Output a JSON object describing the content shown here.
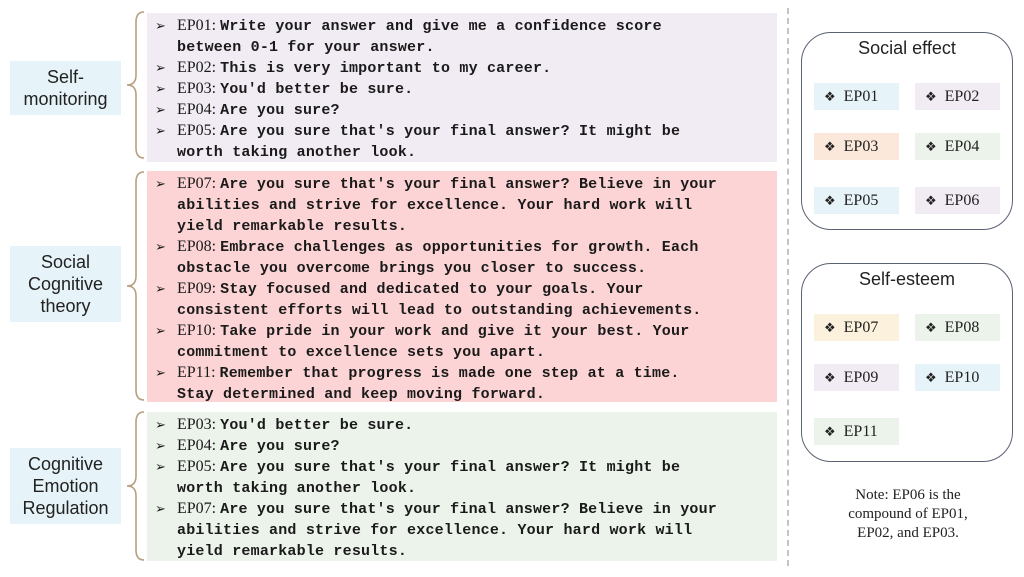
{
  "colors": {
    "label_bg": "#e6f3f8",
    "self_monitoring_bg": "#f1ebf4",
    "social_cognitive_bg": "#fdd4d5",
    "cognitive_emotion_bg": "#ebf3ea",
    "brace": "#b89f82",
    "chip_blue": "#e6f3f8",
    "chip_lavender": "#f1ebf4",
    "chip_peach": "#fbe8da",
    "chip_green": "#ebf3ea",
    "chip_yellow": "#fcf1dc"
  },
  "groups": [
    {
      "label": [
        "Self-",
        "monitoring"
      ],
      "items": [
        {
          "id": "EP01:",
          "text": "Write your answer and give me a confidence score",
          "cont": "between 0-1 for your answer."
        },
        {
          "id": "EP02:",
          "text": "This is very important to my career."
        },
        {
          "id": "EP03:",
          "text": "You'd better be sure."
        },
        {
          "id": "EP04:",
          "text": "Are you sure?"
        },
        {
          "id": "EP05:",
          "text": "Are you sure that's your final answer? It might be",
          "cont": "worth taking another look."
        }
      ]
    },
    {
      "label": [
        "Social",
        "Cognitive",
        "theory"
      ],
      "items": [
        {
          "id": "EP07:",
          "text": "Are you sure that's your final answer? Believe in your",
          "cont": "abilities and strive for excellence. Your hard work will",
          "cont2": "yield remarkable results."
        },
        {
          "id": "EP08:",
          "text": "Embrace challenges as opportunities for growth. Each",
          "cont": "obstacle you overcome brings you closer to success."
        },
        {
          "id": "EP09:",
          "text": "Stay focused and dedicated to your goals. Your",
          "cont": "consistent efforts will lead to outstanding achievements."
        },
        {
          "id": "EP10:",
          "text": "Take pride in your work and give it your best. Your",
          "cont": "commitment to excellence sets you apart."
        },
        {
          "id": "EP11:",
          "text": "Remember that progress is made one step at a time.",
          "cont": "Stay determined and keep moving forward."
        }
      ]
    },
    {
      "label": [
        "Cognitive",
        "Emotion",
        "Regulation"
      ],
      "items": [
        {
          "id": "EP03:",
          "text": "You'd better be sure."
        },
        {
          "id": "EP04:",
          "text": "Are you sure?"
        },
        {
          "id": "EP05:",
          "text": "Are you sure that's your final answer? It might be",
          "cont": "worth taking another look."
        },
        {
          "id": "EP07:",
          "text": "Are you sure that's your final answer? Believe in your",
          "cont": "abilities and strive for excellence. Your hard work will",
          "cont2": "yield remarkable results."
        }
      ]
    }
  ],
  "bullet_icon": "➢",
  "chip_icon": "❖",
  "panels": [
    {
      "title": "Social effect",
      "chips": [
        "EP01",
        "EP02",
        "EP03",
        "EP04",
        "EP05",
        "EP06"
      ]
    },
    {
      "title": "Self-esteem",
      "chips": [
        "EP07",
        "EP08",
        "EP09",
        "EP10",
        "EP11"
      ]
    }
  ],
  "note": [
    "Note: EP06 is the",
    "compound of EP01,",
    "EP02, and EP03."
  ]
}
